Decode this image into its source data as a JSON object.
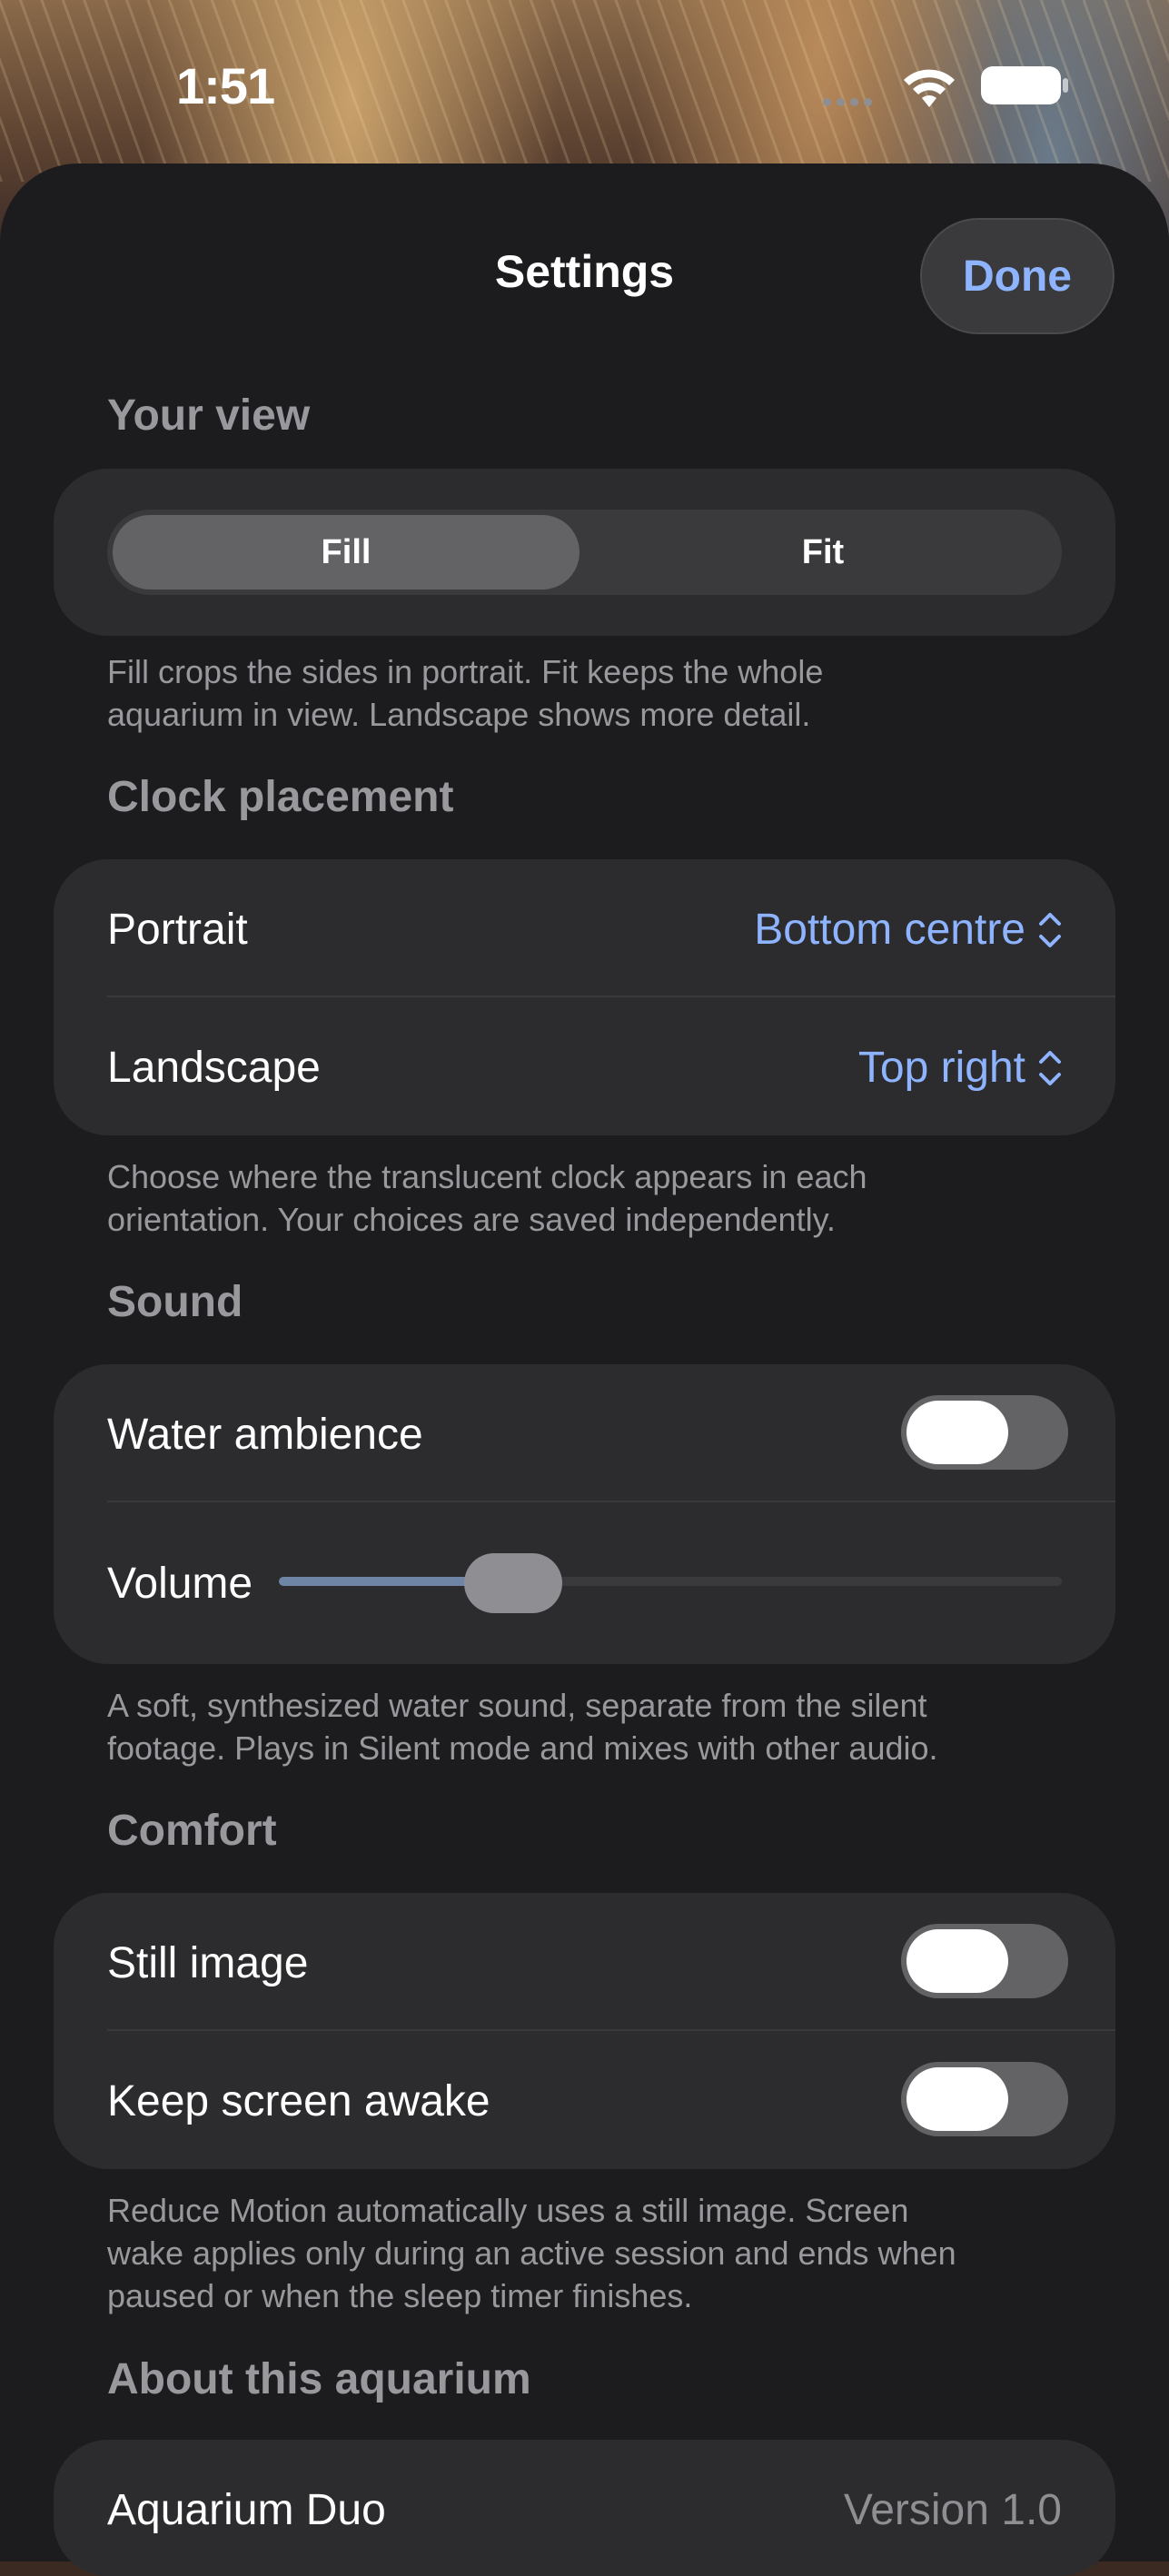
{
  "status_bar": {
    "time": "1:51"
  },
  "header": {
    "title": "Settings",
    "done_label": "Done"
  },
  "your_view": {
    "header": "Your view",
    "options": [
      "Fill",
      "Fit"
    ],
    "selected": "Fill",
    "footnote_line1": "Fill crops the sides in portrait. Fit keeps the whole",
    "footnote_line2": "aquarium in view. Landscape shows more detail."
  },
  "clock_placement": {
    "header": "Clock placement",
    "portrait_label": "Portrait",
    "portrait_value": "Bottom centre",
    "landscape_label": "Landscape",
    "landscape_value": "Top right",
    "footnote_line1": "Choose where the translucent clock appears in each",
    "footnote_line2": "orientation. Your choices are saved independently."
  },
  "sound": {
    "header": "Sound",
    "water_ambience_label": "Water ambience",
    "water_ambience_on": false,
    "volume_label": "Volume",
    "volume_fraction": 0.27,
    "footnote_line1": "A soft, synthesized water sound, separate from the silent",
    "footnote_line2": "footage. Plays in Silent mode and mixes with other audio."
  },
  "comfort": {
    "header": "Comfort",
    "still_image_label": "Still image",
    "still_image_on": false,
    "keep_awake_label": "Keep screen awake",
    "keep_awake_on": false,
    "footnote_line1": "Reduce Motion automatically uses a still image. Screen",
    "footnote_line2": "wake applies only during an active session and ends when",
    "footnote_line3": "paused or when the sleep timer finishes."
  },
  "about": {
    "header": "About this aquarium",
    "app_name": "Aquarium Duo",
    "version": "Version 1.0"
  },
  "colors": {
    "accent": "#8fb4ff",
    "sheet_background": "#1c1c1e",
    "card_background": "#2c2c2e",
    "slider_fill": "#6e85a6"
  },
  "icons": [
    "wifi-icon",
    "battery-icon",
    "chevron-up-down-icon"
  ]
}
